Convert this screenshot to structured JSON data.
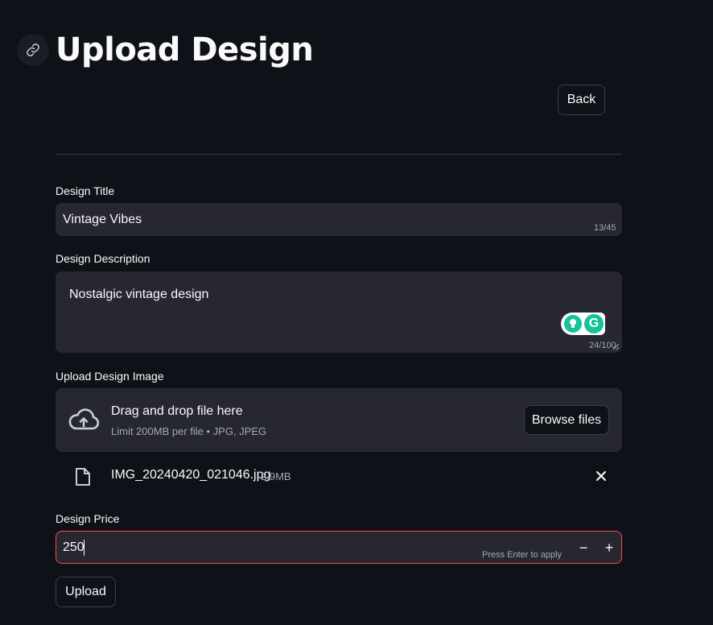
{
  "header": {
    "anchor_icon": "link-icon",
    "title": "Upload Design",
    "back_label": "Back"
  },
  "form": {
    "title_field": {
      "label": "Design Title",
      "value": "Vintage Vibes",
      "counter": "13/45"
    },
    "description_field": {
      "label": "Design Description",
      "value": "Nostalgic vintage design",
      "counter": "24/100"
    },
    "image_upload": {
      "label": "Upload Design Image",
      "drop_text": "Drag and drop file here",
      "limit_text": "Limit 200MB per file • JPG, JPEG",
      "browse_label": "Browse files",
      "uploaded_file": {
        "name": "IMG_20240420_021046.jpg",
        "size": "2.9MB"
      }
    },
    "price_field": {
      "label": "Design Price",
      "value": "250",
      "hint": "Press Enter to apply",
      "decrement": "−",
      "increment": "+"
    },
    "submit_label": "Upload"
  },
  "colors": {
    "background": "#0e1117",
    "input_bg": "#262730",
    "error_border": "#ff4b4b",
    "grammarly": "#15c39a"
  }
}
